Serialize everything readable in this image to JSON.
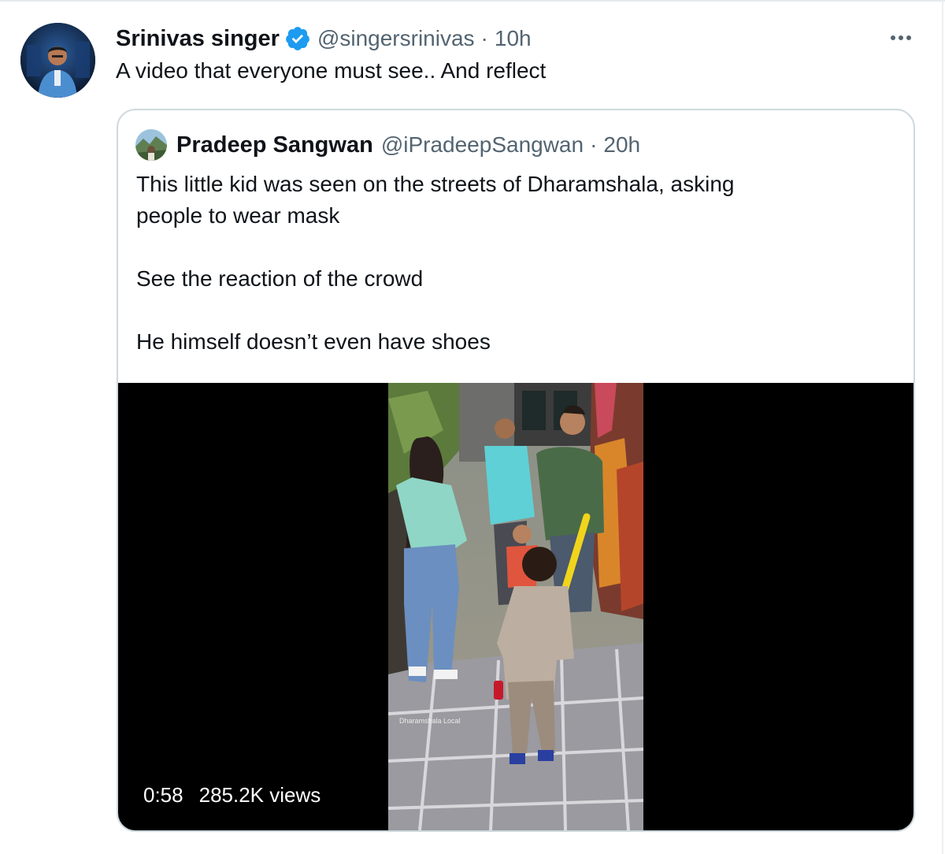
{
  "tweet": {
    "author_name": "Srinivas singer",
    "handle": "@singersrinivas",
    "separator": "·",
    "time": "10h",
    "text": "A video that everyone must see.. And reflect",
    "verified_icon": "verified-badge-icon",
    "more_icon": "more-options-icon"
  },
  "quoted_tweet": {
    "author_name": "Pradeep Sangwan",
    "handle": "@iPradeepSangwan",
    "separator": "·",
    "time": "20h",
    "lines": [
      "This little kid was seen on the streets of Dharamshala, asking",
      "people to wear mask",
      "See the reaction of the crowd",
      "He himself doesn’t even have shoes"
    ],
    "video": {
      "duration": "0:58",
      "views": "285.2K views",
      "watermark": "Dharamshala Local"
    }
  },
  "colors": {
    "text": "#0f1419",
    "secondary": "#536471",
    "verified": "#1d9bf0",
    "border": "#cfd9de"
  }
}
